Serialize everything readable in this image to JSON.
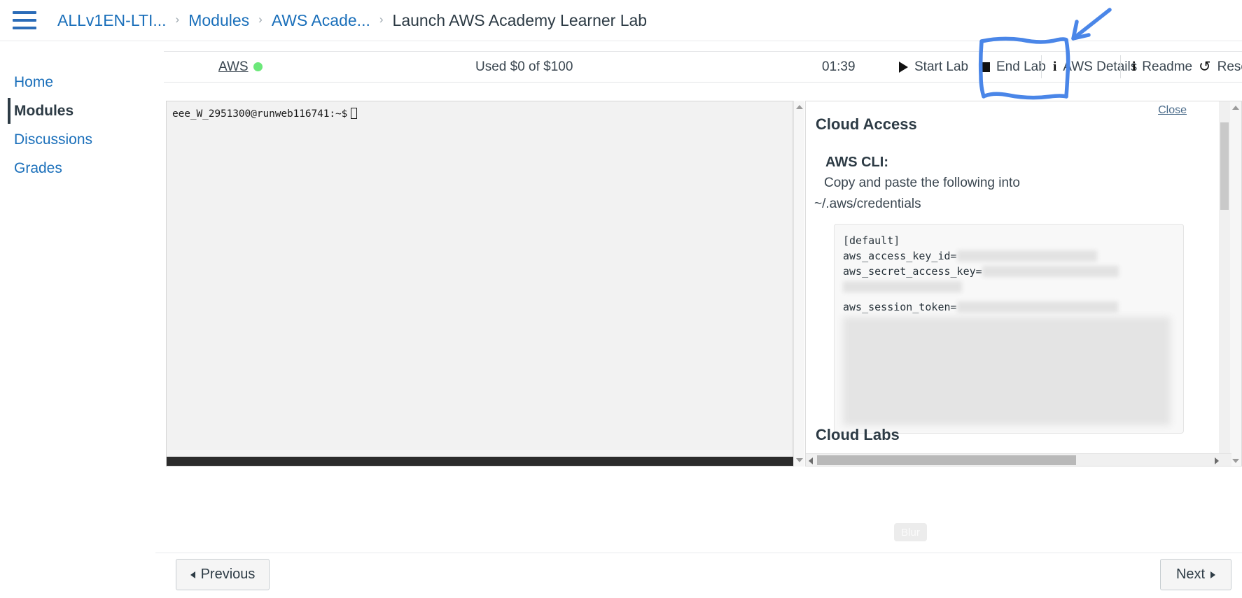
{
  "breadcrumb": {
    "items": [
      {
        "label": "ALLv1EN-LTI...",
        "current": false
      },
      {
        "label": "Modules",
        "current": false
      },
      {
        "label": "AWS Acade...",
        "current": false
      },
      {
        "label": "Launch AWS Academy Learner Lab",
        "current": true
      }
    ],
    "separator": "›",
    "menu_icon": "hamburger-menu-icon"
  },
  "sidebar": {
    "items": [
      {
        "label": "Home",
        "active": false
      },
      {
        "label": "Modules",
        "active": true
      },
      {
        "label": "Discussions",
        "active": false
      },
      {
        "label": "Grades",
        "active": false
      }
    ]
  },
  "labbar": {
    "aws_link": "AWS",
    "aws_status_color": "#6ce87a",
    "used_credit": "Used $0 of $100",
    "timer": "01:39",
    "start_lab": "Start Lab",
    "end_lab": "End Lab",
    "aws_details": "AWS Details",
    "readme": "Readme",
    "reset": "Reset",
    "reset_icon": "↺",
    "fullscreen_icon": "⬌",
    "info_icon": "i"
  },
  "terminal": {
    "prompt": "eee_W_2951300@runweb116741:~$"
  },
  "details_panel": {
    "close_label": "Close",
    "heading": "Cloud Access",
    "cli_heading": "AWS CLI:",
    "cli_instruction_line1": "Copy and paste the following into",
    "cli_instruction_line2": "~/.aws/credentials",
    "credentials": [
      {
        "text": "[default]",
        "redacted": false
      },
      {
        "text": "aws_access_key_id=",
        "redacted": true
      },
      {
        "text": "aws_secret_access_key=",
        "redacted": true
      },
      {
        "text": "aws_session_token=",
        "redacted": true
      }
    ],
    "labs_heading": "Cloud Labs"
  },
  "blur_badge": {
    "label": "Blur"
  },
  "pager": {
    "previous": "Previous",
    "next": "Next"
  },
  "annotation": {
    "color": "#4a86e8",
    "shapes": "hand-drawn-rectangle-around-aws-details-with-arrow"
  }
}
